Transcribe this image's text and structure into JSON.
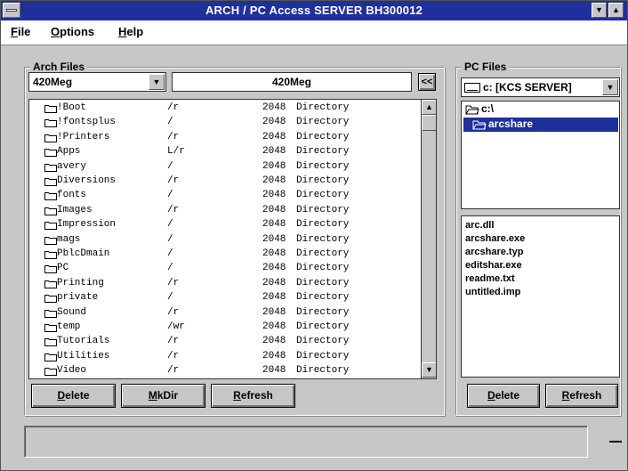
{
  "window": {
    "title": "ARCH / PC Access SERVER BH300012",
    "minimize_glyph": "▼",
    "maximize_glyph": "▲"
  },
  "menu": {
    "items": [
      {
        "label": "File",
        "accel": "F",
        "rest": "ile"
      },
      {
        "label": "Options",
        "accel": "O",
        "rest": "ptions"
      },
      {
        "label": "Help",
        "accel": "H",
        "rest": "elp"
      }
    ]
  },
  "arch": {
    "group_label": "Arch Files",
    "drive_selected": "420Meg",
    "path_display": "420Meg",
    "back_glyph": "<<",
    "files": [
      {
        "name": "!Boot",
        "perm": "/r",
        "size": "2048",
        "type": "Directory"
      },
      {
        "name": "!fontsplus",
        "perm": "/",
        "size": "2048",
        "type": "Directory"
      },
      {
        "name": "!Printers",
        "perm": "/r",
        "size": "2048",
        "type": "Directory"
      },
      {
        "name": "Apps",
        "perm": "L/r",
        "size": "2048",
        "type": "Directory"
      },
      {
        "name": "avery",
        "perm": "/",
        "size": "2048",
        "type": "Directory"
      },
      {
        "name": "Diversions",
        "perm": "/r",
        "size": "2048",
        "type": "Directory"
      },
      {
        "name": "fonts",
        "perm": "/",
        "size": "2048",
        "type": "Directory"
      },
      {
        "name": "Images",
        "perm": "/r",
        "size": "2048",
        "type": "Directory"
      },
      {
        "name": "Impression",
        "perm": "/",
        "size": "2048",
        "type": "Directory"
      },
      {
        "name": "mags",
        "perm": "/",
        "size": "2048",
        "type": "Directory"
      },
      {
        "name": "PblcDmain",
        "perm": "/",
        "size": "2048",
        "type": "Directory"
      },
      {
        "name": "PC",
        "perm": "/",
        "size": "2048",
        "type": "Directory"
      },
      {
        "name": "Printing",
        "perm": "/r",
        "size": "2048",
        "type": "Directory"
      },
      {
        "name": "private",
        "perm": "/",
        "size": "2048",
        "type": "Directory"
      },
      {
        "name": "Sound",
        "perm": "/r",
        "size": "2048",
        "type": "Directory"
      },
      {
        "name": "temp",
        "perm": "/wr",
        "size": "2048",
        "type": "Directory"
      },
      {
        "name": "Tutorials",
        "perm": "/r",
        "size": "2048",
        "type": "Directory"
      },
      {
        "name": "Utilities",
        "perm": "/r",
        "size": "2048",
        "type": "Directory"
      },
      {
        "name": "Video",
        "perm": "/r",
        "size": "2048",
        "type": "Directory"
      }
    ],
    "buttons": {
      "delete": {
        "accel": "D",
        "rest": "elete"
      },
      "mkdir": {
        "accel": "M",
        "rest": "kDir"
      },
      "refresh": {
        "accel": "R",
        "rest": "efresh"
      }
    }
  },
  "pc": {
    "group_label": "PC Files",
    "drive_selected": "c: [KCS SERVER]",
    "dirs": [
      {
        "label": "c:\\",
        "selected": false
      },
      {
        "label": "arcshare",
        "selected": true
      }
    ],
    "files": [
      "arc.dll",
      "arcshare.exe",
      "arcshare.typ",
      "editshar.exe",
      "readme.txt",
      "untitled.imp"
    ],
    "buttons": {
      "delete": {
        "accel": "D",
        "rest": "elete"
      },
      "refresh": {
        "accel": "R",
        "rest": "efresh"
      }
    }
  },
  "status": {
    "text": ""
  },
  "colors": {
    "titlebar": "#1f2f9c",
    "selection": "#1f2f9c",
    "face": "#c7c7c7"
  }
}
